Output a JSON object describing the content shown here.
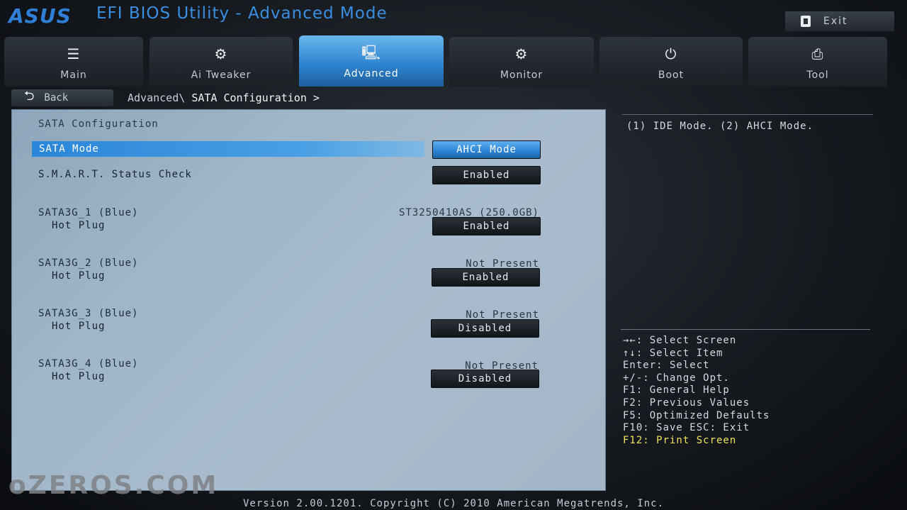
{
  "header": {
    "logo_text": "ASUS",
    "title": "EFI BIOS Utility - Advanced Mode",
    "exit_label": "Exit"
  },
  "tabs": [
    {
      "label": "Main",
      "icon": "list-icon",
      "glyph": "☰"
    },
    {
      "label": "Ai Tweaker",
      "icon": "tweaker-icon",
      "glyph": "⚙"
    },
    {
      "label": "Advanced",
      "icon": "advanced-icon",
      "glyph": "🖳"
    },
    {
      "label": "Monitor",
      "icon": "monitor-icon",
      "glyph": "⚙"
    },
    {
      "label": "Boot",
      "icon": "power-icon",
      "glyph": "⏻"
    },
    {
      "label": "Tool",
      "icon": "tool-icon",
      "glyph": "⎙"
    }
  ],
  "active_tab": "Advanced",
  "nav": {
    "back_label": "Back",
    "breadcrumb_parent": "Advanced\\",
    "breadcrumb_current": "SATA Configuration >"
  },
  "panel": {
    "section_title": "SATA Configuration",
    "sata_mode": {
      "label": "SATA Mode",
      "value": "AHCI Mode"
    },
    "smart": {
      "label": "S.M.A.R.T. Status Check",
      "value": "Enabled"
    },
    "ports": [
      {
        "name": "SATA3G_1 (Blue)",
        "sub": "Hot Plug",
        "device": "ST3250410AS (250.0GB)",
        "value": "Enabled"
      },
      {
        "name": "SATA3G_2 (Blue)",
        "sub": "Hot Plug",
        "device": "Not Present",
        "value": "Enabled"
      },
      {
        "name": "SATA3G_3 (Blue)",
        "sub": "Hot Plug",
        "device": "Not Present",
        "value": "Disabled"
      },
      {
        "name": "SATA3G_4 (Blue)",
        "sub": "Hot Plug",
        "device": "Not Present",
        "value": "Disabled"
      }
    ]
  },
  "help": {
    "description": "(1) IDE Mode. (2) AHCI Mode.",
    "keys": [
      "→←: Select Screen",
      "↑↓: Select Item",
      "Enter: Select",
      "+/-: Change Opt.",
      "F1: General Help",
      "F2: Previous Values",
      "F5: Optimized Defaults",
      "F10: Save  ESC: Exit"
    ],
    "highlight_key": "F12: Print Screen"
  },
  "watermark": "oZEROS.COM",
  "footer": "Version 2.00.1201. Copyright (C) 2010 American Megatrends, Inc.",
  "colors": {
    "accent": "#2f86d1",
    "panel_bg": "#9fb5c8",
    "highlight_text": "#f2e35a"
  }
}
